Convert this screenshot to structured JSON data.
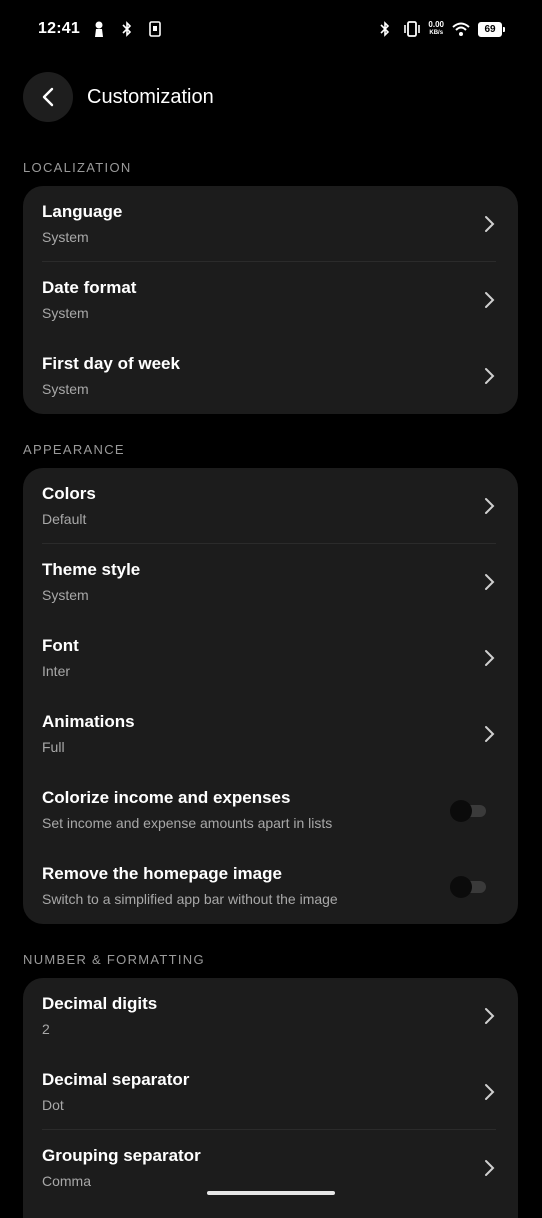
{
  "status_bar": {
    "time": "12:41",
    "net_speed_value": "0.00",
    "net_speed_unit": "KB/s",
    "battery": "69"
  },
  "header": {
    "title": "Customization"
  },
  "sections": {
    "localization": {
      "label": "LOCALIZATION",
      "items": [
        {
          "title": "Language",
          "subtitle": "System"
        },
        {
          "title": "Date format",
          "subtitle": "System"
        },
        {
          "title": "First day of week",
          "subtitle": "System"
        }
      ]
    },
    "appearance": {
      "label": "APPEARANCE",
      "items": [
        {
          "title": "Colors",
          "subtitle": "Default"
        },
        {
          "title": "Theme style",
          "subtitle": "System"
        },
        {
          "title": "Font",
          "subtitle": "Inter"
        },
        {
          "title": "Animations",
          "subtitle": "Full"
        },
        {
          "title": "Colorize income and expenses",
          "subtitle": "Set income and expense amounts apart in lists",
          "toggle": false
        },
        {
          "title": "Remove the homepage image",
          "subtitle": "Switch to a simplified app bar without the image",
          "toggle": false
        }
      ]
    },
    "number_formatting": {
      "label": "NUMBER & FORMATTING",
      "items": [
        {
          "title": "Decimal digits",
          "subtitle": "2"
        },
        {
          "title": "Decimal separator",
          "subtitle": "Dot"
        },
        {
          "title": "Grouping separator",
          "subtitle": "Comma"
        }
      ]
    }
  },
  "colors": {
    "background": "#000000",
    "card": "#1c1c1c",
    "subtitle": "#a8a8a8",
    "section_label": "#9a9a9a"
  }
}
